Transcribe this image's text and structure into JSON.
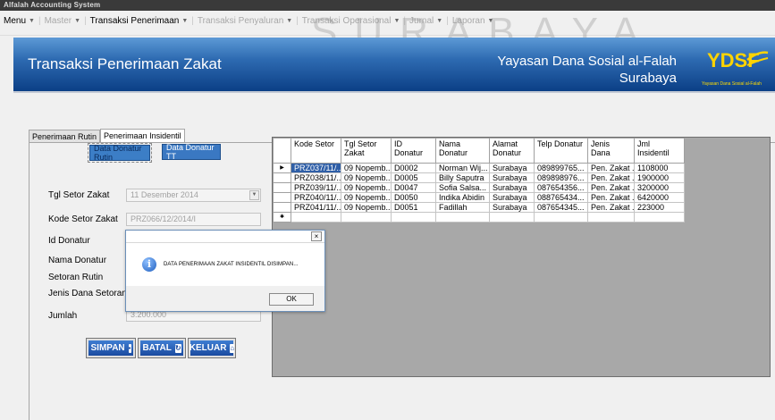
{
  "window": {
    "title": "Alfalah Accounting System"
  },
  "watermark": "SURABAYA",
  "menu": {
    "items": [
      {
        "label": "Menu",
        "dim": false
      },
      {
        "label": "Master",
        "dim": true
      },
      {
        "label": "Transaksi Penerimaan",
        "dim": false
      },
      {
        "label": "Transaksi Penyaluran",
        "dim": true
      },
      {
        "label": "Transaksi Operasional",
        "dim": true
      },
      {
        "label": "Jurnal",
        "dim": true
      },
      {
        "label": "Laporan",
        "dim": true
      }
    ]
  },
  "header": {
    "title": "Transaksi Penerimaan Zakat",
    "org_line1": "Yayasan Dana Sosial al-Falah",
    "org_line2": "Surabaya",
    "logo_text": "YDSF",
    "logo_subtext": "Yayasan Dana Sosial al-Falah"
  },
  "tabs": [
    {
      "label": "Penerimaan Rutin",
      "active": false
    },
    {
      "label": "Penerimaan Insidentil",
      "active": true
    }
  ],
  "form": {
    "btn_data_donatur_rutin": "Data Donatur Rutin",
    "btn_data_donatur_tt": "Data Donatur TT",
    "tgl_setor_label": "Tgl Setor Zakat",
    "tgl_setor_value": "11 Desember 2014",
    "kode_setor_label": "Kode Setor Zakat",
    "kode_setor_value": "PRZ066/12/2014/I",
    "id_donatur_label": "Id Donatur",
    "nama_donatur_label": "Nama Donatur",
    "setoran_rutin_label": "Setoran Rutin",
    "jenis_dana_label": "Jenis Dana Setoran",
    "jumlah_label": "Jumlah",
    "jumlah_value": "3.200.000",
    "simpan": "SIMPAN",
    "batal": "BATAL",
    "keluar": "KELUAR"
  },
  "grid": {
    "columns": [
      "Kode Setor",
      "Tgl Setor Zakat",
      "ID Donatur",
      "Nama Donatur",
      "Alamat Donatur",
      "Telp Donatur",
      "Jenis Dana",
      "Jml Insidentil"
    ],
    "rows": [
      [
        "PRZ037/11/...",
        "09 Nopemb...",
        "D0002",
        "Norman Wij...",
        "Surabaya",
        "089899765...",
        "Pen. Zakat ...",
        "1108000"
      ],
      [
        "PRZ038/11/...",
        "09 Nopemb...",
        "D0005",
        "Billy Saputra",
        "Surabaya",
        "089898976...",
        "Pen. Zakat ...",
        "1900000"
      ],
      [
        "PRZ039/11/...",
        "09 Nopemb...",
        "D0047",
        "Sofia Salsa...",
        "Surabaya",
        "087654356...",
        "Pen. Zakat ...",
        "3200000"
      ],
      [
        "PRZ040/11/...",
        "09 Nopemb...",
        "D0050",
        "Indika Abidin",
        "Surabaya",
        "088765434...",
        "Pen. Zakat ...",
        "6420000"
      ],
      [
        "PRZ041/11/...",
        "09 Nopemb...",
        "D0051",
        "Fadillah",
        "Surabaya",
        "087654345...",
        "Pen. Zakat ...",
        "223000"
      ]
    ]
  },
  "dialog": {
    "message": "DATA PENERIMAAN ZAKAT INSIDENTIL DISIMPAN...",
    "ok": "OK",
    "close": "×"
  }
}
